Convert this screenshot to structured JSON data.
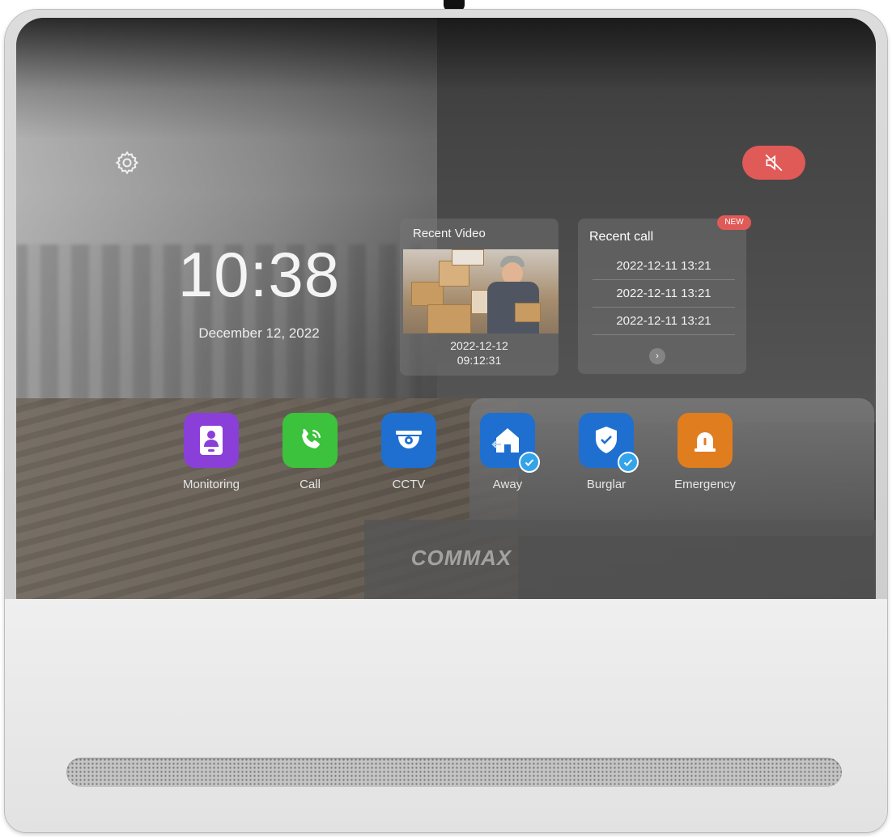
{
  "brand": {
    "logo_text": "COMMAX"
  },
  "status_bar": {
    "settings_icon": "gear-icon",
    "mute_icon": "speaker-muted-icon",
    "mute_color": "#e05a58"
  },
  "clock": {
    "time": "10:38",
    "date": "December 12, 2022"
  },
  "recent_video": {
    "title": "Recent Video",
    "date": "2022-12-12",
    "time": "09:12:31"
  },
  "recent_call": {
    "title": "Recent call",
    "badge": "NEW",
    "entries": [
      "2022-12-11 13:21",
      "2022-12-11 13:21",
      "2022-12-11 13:21"
    ],
    "more_icon": "chevron-right-icon"
  },
  "apps": [
    {
      "label": "Monitoring",
      "icon": "intercom-icon",
      "color": "#8b3fd9",
      "checked": false
    },
    {
      "label": "Call",
      "icon": "phone-icon",
      "color": "#3cc23c",
      "checked": false
    },
    {
      "label": "CCTV",
      "icon": "dome-camera-icon",
      "color": "#1e6fd0",
      "checked": false
    },
    {
      "label": "Away",
      "icon": "home-away-icon",
      "color": "#1e6fd0",
      "checked": true
    },
    {
      "label": "Burglar",
      "icon": "shield-icon",
      "color": "#1e6fd0",
      "checked": true
    },
    {
      "label": "Emergency",
      "icon": "alarm-bell-icon",
      "color": "#e07d1e",
      "checked": false
    }
  ]
}
